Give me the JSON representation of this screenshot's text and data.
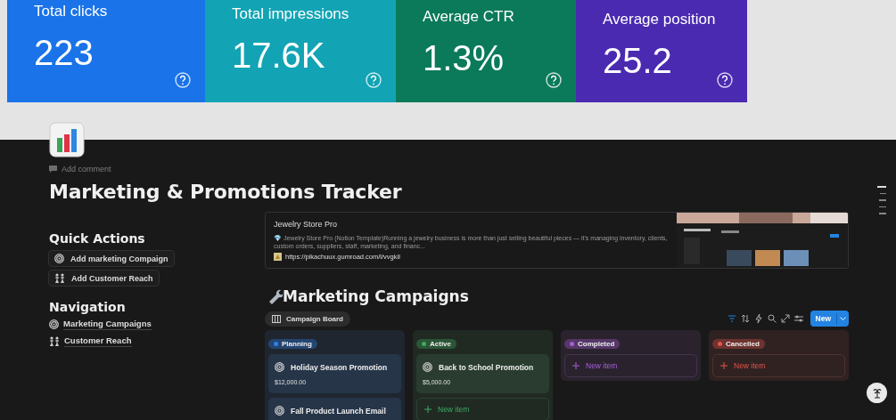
{
  "metrics": [
    {
      "label": "Total clicks",
      "value": "223",
      "color": "#1a73e8"
    },
    {
      "label": "Total impressions",
      "value": "17.6K",
      "color": "#12a4b4"
    },
    {
      "label": "Average CTR",
      "value": "1.3%",
      "color": "#0b7a5a"
    },
    {
      "label": "Average position",
      "value": "25.2",
      "color": "#4a2ab0"
    }
  ],
  "page": {
    "add_comment": "Add comment",
    "title": "Marketing & Promotions Tracker"
  },
  "quick_actions": {
    "heading": "Quick Actions",
    "items": [
      {
        "label": "Add marketing Compaign",
        "kind": "target"
      },
      {
        "label": "Add Customer Reach",
        "kind": "people"
      }
    ]
  },
  "navigation": {
    "heading": "Navigation",
    "items": [
      {
        "label": "Marketing Campaigns",
        "kind": "target"
      },
      {
        "label": "Customer Reach",
        "kind": "people"
      }
    ]
  },
  "bookmark": {
    "title": "Jewelry Store Pro",
    "description": "💎 Jewelry Store Pro (Notion Template)Running a jewelry business is more than just selling beautiful pieces — it's managing inventory, clients, custom orders, suppliers, staff, marketing, and financ...",
    "url": "https://pikachuux.gumroad.com/l/vvgkil"
  },
  "database": {
    "title": "Marketing Campaigns",
    "view": "Campaign Board",
    "new_button": "New",
    "columns": [
      {
        "label": "Planning",
        "color": "#2f80ed",
        "cards": [
          {
            "title": "Holiday Season Promotion",
            "amount": "$12,000.00"
          },
          {
            "title": "Fall Product Launch Email"
          }
        ]
      },
      {
        "label": "Active",
        "color": "#3fa85f",
        "cards": [
          {
            "title": "Back to School Promotion",
            "amount": "$5,000.00"
          }
        ],
        "new_item": "New item"
      },
      {
        "label": "Completed",
        "color": "#a95ed8",
        "new_item": "New item"
      },
      {
        "label": "Cancelled",
        "color": "#e5534b",
        "new_item": "New item"
      }
    ]
  }
}
